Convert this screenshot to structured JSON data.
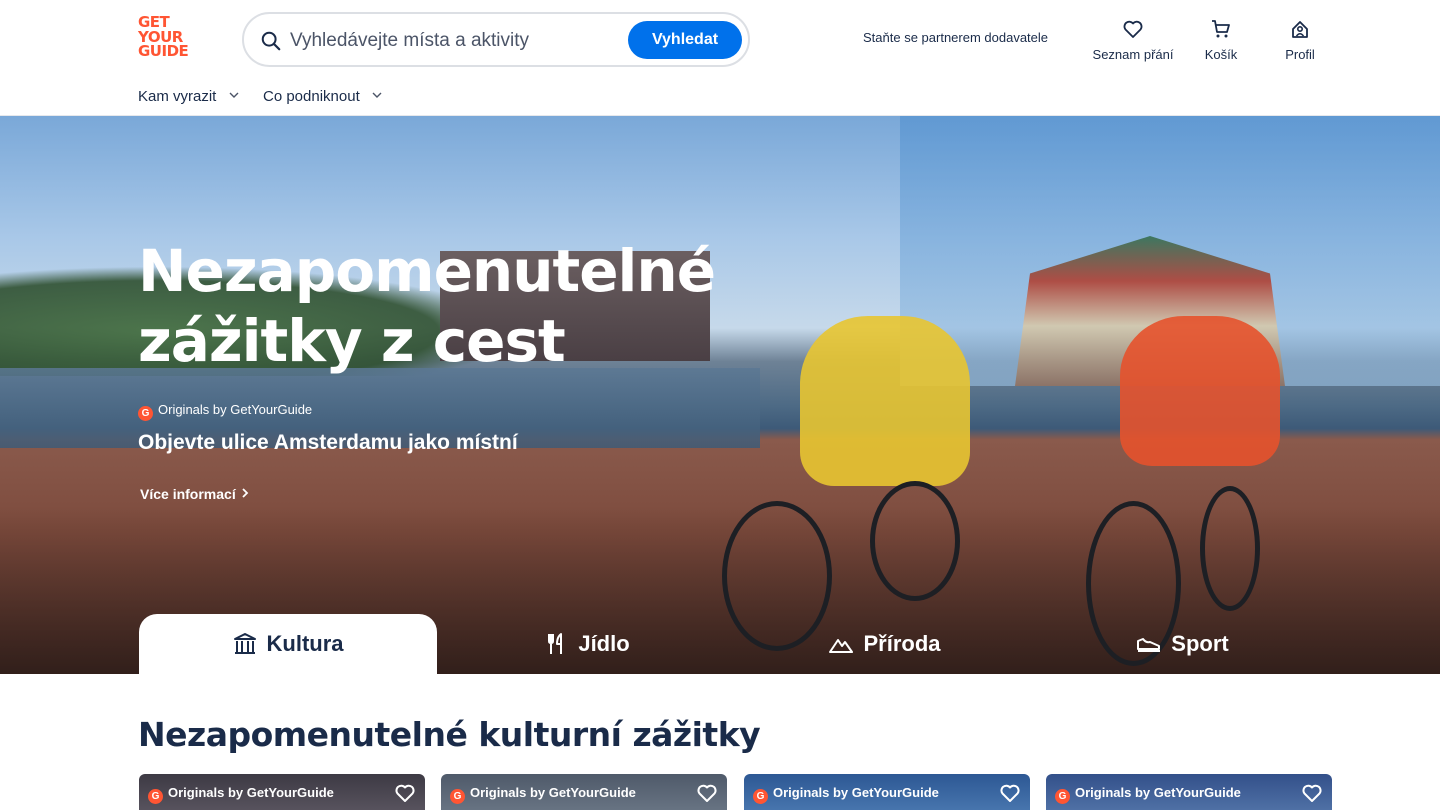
{
  "brand": {
    "logo_lines": [
      "GET",
      "YOUR",
      "GUIDE"
    ],
    "color": "#ff5533"
  },
  "search": {
    "placeholder": "Vyhledávejte místa a aktivity",
    "button_label": "Vyhledat",
    "icon": "search-icon"
  },
  "header": {
    "partner_link": "Staňte se partnerem dodavatele",
    "wishlist_label": "Seznam přání",
    "cart_label": "Košík",
    "profile_label": "Profil"
  },
  "nav": {
    "items": [
      {
        "label": "Kam vyrazit"
      },
      {
        "label": "Co podniknout"
      }
    ]
  },
  "hero": {
    "title": "Nezapomenutelné zážitky z cest",
    "originals_label": "Originals by GetYourGuide",
    "subtitle": "Objevte ulice Amsterdamu jako místní",
    "more_link": "Více informací"
  },
  "tabs": [
    {
      "label": "Kultura",
      "icon": "museum-icon",
      "active": true
    },
    {
      "label": "Jídlo",
      "icon": "fork-knife-icon",
      "active": false
    },
    {
      "label": "Příroda",
      "icon": "mountain-icon",
      "active": false
    },
    {
      "label": "Sport",
      "icon": "sport-shoe-icon",
      "active": false
    }
  ],
  "section": {
    "title": "Nezapomenutelné kulturní zážitky",
    "cards": [
      {
        "badge": "Originals by GetYourGuide"
      },
      {
        "badge": "Originals by GetYourGuide"
      },
      {
        "badge": "Originals by GetYourGuide"
      },
      {
        "badge": "Originals by GetYourGuide"
      }
    ]
  },
  "colors": {
    "primary_button": "#0071eb",
    "text_dark": "#1a2b49",
    "brand_orange": "#ff5533"
  }
}
